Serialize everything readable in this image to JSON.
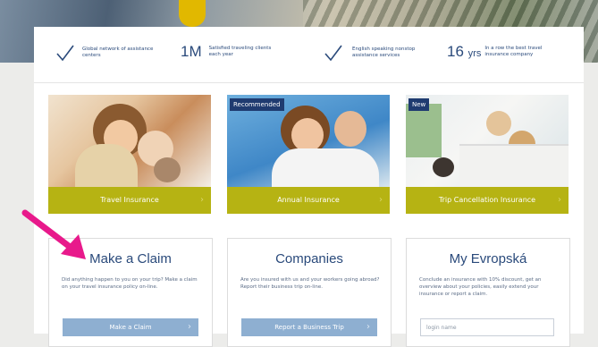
{
  "stats": [
    {
      "value": "",
      "text": "Global network of assistance centers"
    },
    {
      "value": "1M",
      "text": "Satisfied traveling clients each year"
    },
    {
      "value": "",
      "text": "English speaking nonstop assistance services"
    },
    {
      "value": "16",
      "unit": "yrs",
      "text": "In a row the best travel insurance company"
    }
  ],
  "cards": [
    {
      "badge": "",
      "label": "Travel Insurance"
    },
    {
      "badge": "Recommended",
      "label": "Annual Insurance"
    },
    {
      "badge": "New",
      "label": "Trip Cancellation Insurance"
    }
  ],
  "boxes": [
    {
      "title": "Make a Claim",
      "text": "Did anything happen to you on your trip? Make a claim on your travel insurance policy on-line.",
      "button": "Make a Claim"
    },
    {
      "title": "Companies",
      "text": "Are you insured with us and your workers going abroad? Report their business trip on-line.",
      "button": "Report a Business Trip"
    },
    {
      "title": "My Evropská",
      "text": "Conclude an insurance with 10% discount, get an overview about your policies, easily extend your insurance or report a claim.",
      "placeholder": "login name"
    }
  ],
  "colors": {
    "accent": "#b6b313",
    "brand": "#1f3b70",
    "button": "#8eafd1",
    "arrow": "#e8198b"
  }
}
